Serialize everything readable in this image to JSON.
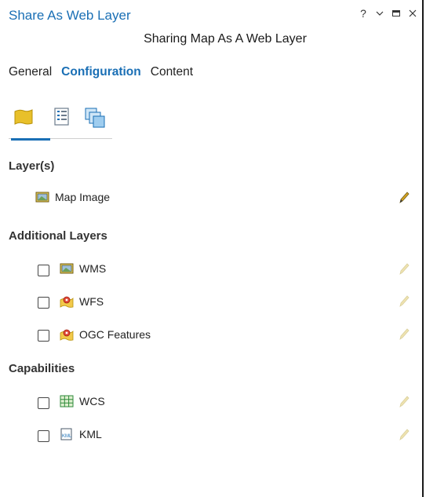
{
  "pane": {
    "title": "Share As Web Layer",
    "subtitle": "Sharing Map As A Web Layer",
    "controls": {
      "help": "?",
      "menu": "⌄",
      "maximize": "□",
      "close": "×"
    }
  },
  "tabs": [
    {
      "label": "General",
      "active": false
    },
    {
      "label": "Configuration",
      "active": true
    },
    {
      "label": "Content",
      "active": false
    }
  ],
  "icon_tabs": [
    "layers-icon",
    "properties-icon",
    "pages-icon"
  ],
  "sections": {
    "layers": {
      "header": "Layer(s)",
      "items": [
        {
          "label": "Map Image",
          "icon": "map-image-icon"
        }
      ]
    },
    "additional": {
      "header": "Additional Layers",
      "items": [
        {
          "label": "WMS",
          "icon": "map-image-icon",
          "checked": false
        },
        {
          "label": "WFS",
          "icon": "feature-icon",
          "checked": false
        },
        {
          "label": "OGC Features",
          "icon": "feature-icon",
          "checked": false
        }
      ]
    },
    "capabilities": {
      "header": "Capabilities",
      "items": [
        {
          "label": "WCS",
          "icon": "grid-icon",
          "checked": false
        },
        {
          "label": "KML",
          "icon": "kml-icon",
          "checked": false
        }
      ]
    }
  },
  "colors": {
    "accent": "#1a6fb5",
    "pencil_active": "#8a6a00",
    "pencil_disabled": "#d9cf9c"
  }
}
